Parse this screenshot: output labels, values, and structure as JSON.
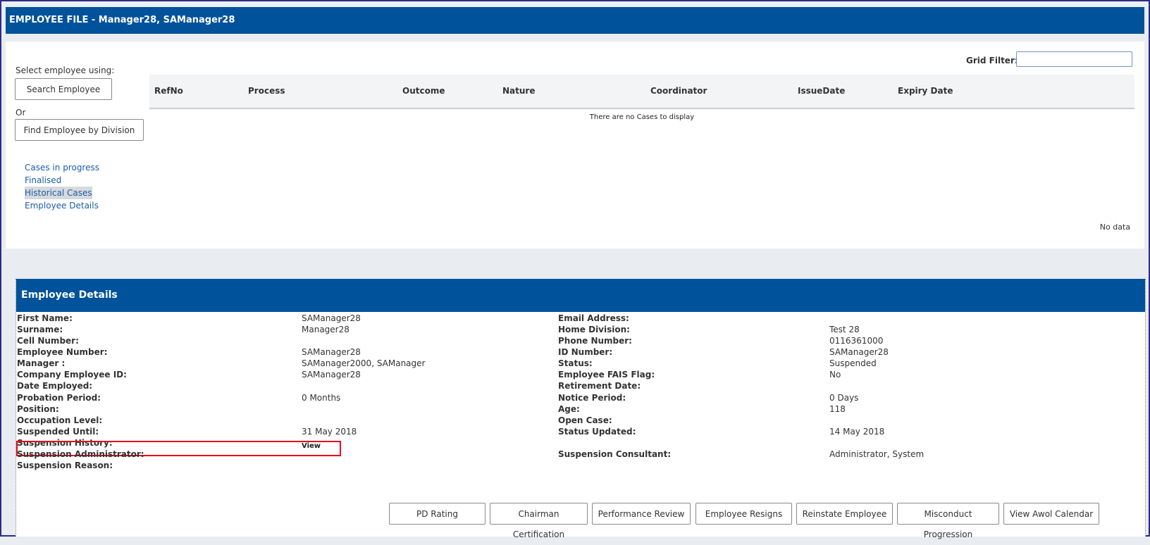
{
  "window": {
    "title": "EMPLOYEE FILE - Manager28, SAManager28"
  },
  "select_panel": {
    "label": "Select employee using:",
    "search_button": "Search Employee",
    "or_label": "Or",
    "division_button": "Find Employee by Division",
    "links": [
      {
        "label": "Cases in progress",
        "selected": false
      },
      {
        "label": "Finalised",
        "selected": false
      },
      {
        "label": "Historical Cases",
        "selected": true
      },
      {
        "label": "Employee Details",
        "selected": false
      }
    ]
  },
  "grid": {
    "filter_label": "Grid Filter:",
    "filter_value": "",
    "columns": [
      "RefNo",
      "Process",
      "Outcome",
      "Nature",
      "Coordinator",
      "IssueDate",
      "Expiry Date"
    ],
    "empty_message": "There are no Cases to display",
    "no_data": "No data"
  },
  "employee_details": {
    "header": "Employee Details",
    "left_fields": [
      {
        "label": "First Name:",
        "value": "SAManager28"
      },
      {
        "label": "Surname:",
        "value": "Manager28"
      },
      {
        "label": "Cell Number:",
        "value": ""
      },
      {
        "label": "Employee Number:",
        "value": "SAManager28"
      },
      {
        "label": "Manager :",
        "value": "SAManager2000, SAManager"
      },
      {
        "label": "Company Employee ID:",
        "value": "SAManager28"
      },
      {
        "label": "Date Employed:",
        "value": ""
      },
      {
        "label": "Probation Period:",
        "value": "0 Months"
      },
      {
        "label": "Position:",
        "value": ""
      },
      {
        "label": "Occupation Level:",
        "value": ""
      },
      {
        "label": "Suspended Until:",
        "value": "31 May 2018"
      },
      {
        "label": "Suspension History:",
        "value": ""
      },
      {
        "label": "Suspension Administrator:",
        "value": ""
      },
      {
        "label": "Suspension Reason:",
        "value": ""
      }
    ],
    "right_fields": [
      {
        "label": "Email Address:",
        "value": ""
      },
      {
        "label": "Home Division:",
        "value": "Test 28"
      },
      {
        "label": "Phone Number:",
        "value": "0116361000"
      },
      {
        "label": "ID Number:",
        "value": "SAManager28"
      },
      {
        "label": "Status:",
        "value": "Suspended"
      },
      {
        "label": "Employee FAIS Flag:",
        "value": "No"
      },
      {
        "label": "Retirement Date:",
        "value": ""
      },
      {
        "label": "Notice Period:",
        "value": "0 Days"
      },
      {
        "label": "Age:",
        "value": "118"
      },
      {
        "label": "Open Case:",
        "value": ""
      },
      {
        "label": "Status Updated:",
        "value": "14 May 2018"
      },
      {
        "label": "",
        "value": ""
      },
      {
        "label": "Suspension Consultant:",
        "value": "Administrator, System"
      }
    ],
    "suspension_history_link": "View",
    "actions": [
      "PD Rating",
      "Chairman Certification",
      "Performance Review",
      "Employee Resigns",
      "Reinstate Employee",
      "Misconduct Progression",
      "View Awol Calendar"
    ]
  },
  "colors": {
    "header_blue": "#00529b",
    "link_blue": "#1b5ea8",
    "highlight_red": "#e0101a"
  }
}
